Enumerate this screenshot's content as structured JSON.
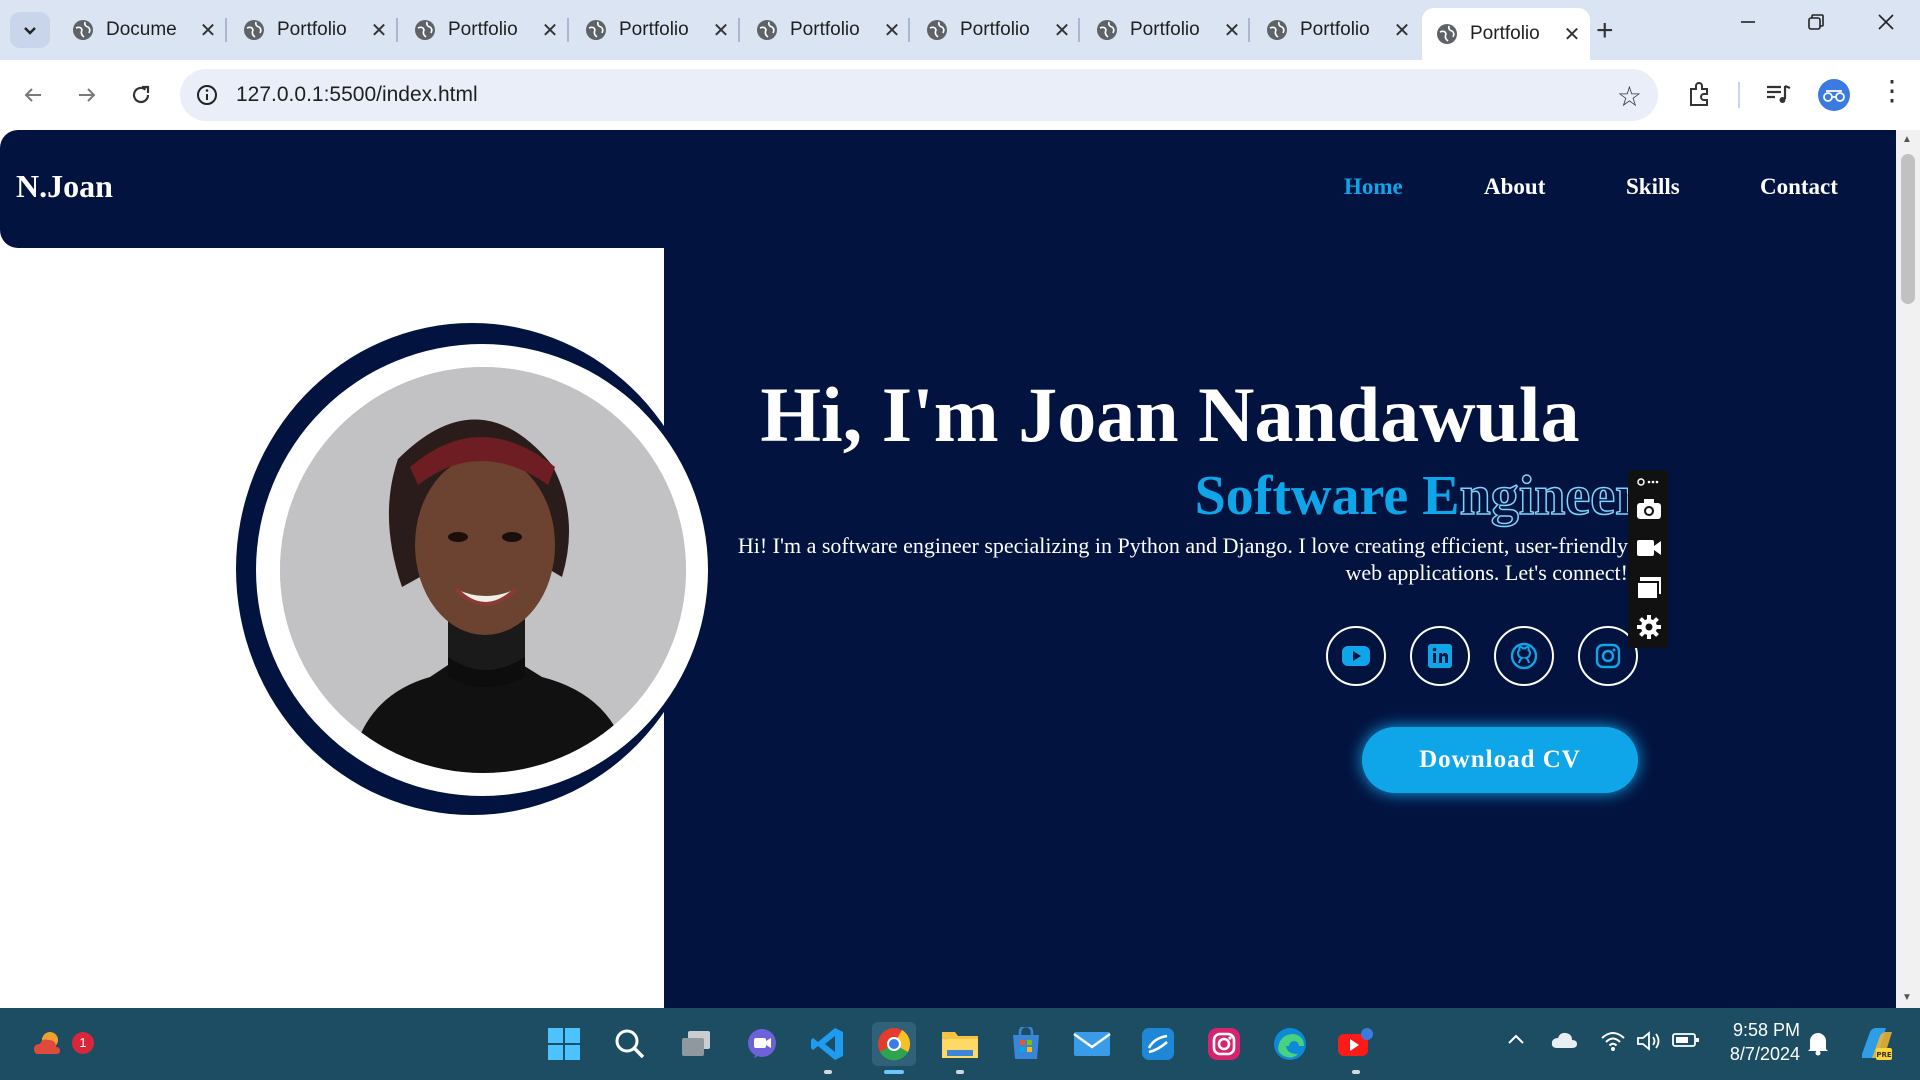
{
  "browser": {
    "tabs": [
      {
        "title": "Docume",
        "active": false
      },
      {
        "title": "Portfolio",
        "active": false
      },
      {
        "title": "Portfolio",
        "active": false
      },
      {
        "title": "Portfolio",
        "active": false
      },
      {
        "title": "Portfolio",
        "active": false
      },
      {
        "title": "Portfolio",
        "active": false
      },
      {
        "title": "Portfolio",
        "active": false
      },
      {
        "title": "Portfolio",
        "active": false
      },
      {
        "title": "Portfolio",
        "active": true
      }
    ],
    "tab_close": "✕",
    "new_tab": "+",
    "url": "127.0.0.1:5500/index.html"
  },
  "site": {
    "logo": "N.Joan",
    "nav": {
      "home": "Home",
      "about": "About",
      "skills": "Skills",
      "contact": "Contact"
    },
    "hero": {
      "title": "Hi, I'm Joan Nandawula",
      "subtitle_fill": "Software E",
      "subtitle_outline": "ngineer",
      "description": "Hi! I'm a software engineer specializing in Python and Django. I love creating efficient, user-friendly web applications. Let's connect!",
      "cv_button": "Download CV"
    },
    "social_icons": [
      "youtube-icon",
      "linkedin-icon",
      "github-icon",
      "instagram-icon"
    ]
  },
  "taskbar": {
    "time": "9:58 PM",
    "date": "8/7/2024",
    "notification_count": "1"
  },
  "colors": {
    "navy": "#03133f",
    "accent": "#0ea5e9",
    "taskbar": "#1c4d63"
  }
}
